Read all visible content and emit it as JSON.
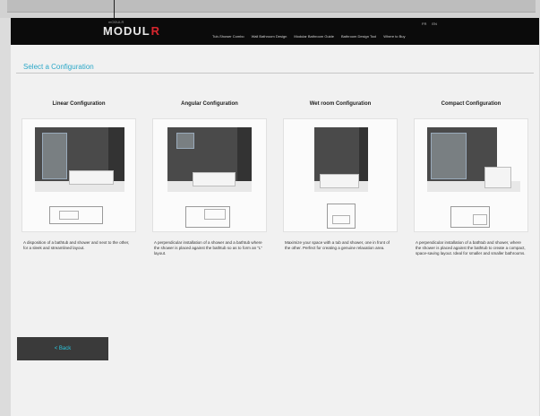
{
  "header": {
    "brand_super": "mODULR",
    "brand_main": "MODUL",
    "brand_accent": "R",
    "language_links": [
      "FR",
      "EN"
    ],
    "nav_links": [
      "Tub-Shower Combo",
      "Wall Bathroom Design",
      "Modular Bathroom Guide",
      "Bathroom Design Tool",
      "Where to Buy"
    ]
  },
  "page": {
    "title": "Select a Configuration"
  },
  "configurations": [
    {
      "title": "Linear Configuration",
      "description": "A disposition of a bathtub and shower and next to the other, for a sleek and streamlined layout."
    },
    {
      "title": "Angular Configuration",
      "description": "A perpendicular installation of a shower and a bathtub where the shower is placed against the bathtub so as to form an \"L\" layout."
    },
    {
      "title": "Wet room Configuration",
      "description": "Maximize your space with a tub and shower, one in front of the other. Perfect for creating a genuine relaxation area."
    },
    {
      "title": "Compact Configuration",
      "description": "A perpendicular installation of a bathtub and shower, where the shower is placed against the bathtub to create a compact, space-saving layout. Ideal for smaller and smaller bathrooms."
    }
  ],
  "footer": {
    "back_label": "< Back"
  },
  "colors": {
    "accent": "#2ca8c8",
    "brand_red": "#d8262e",
    "navbar": "#0b0b0b"
  }
}
